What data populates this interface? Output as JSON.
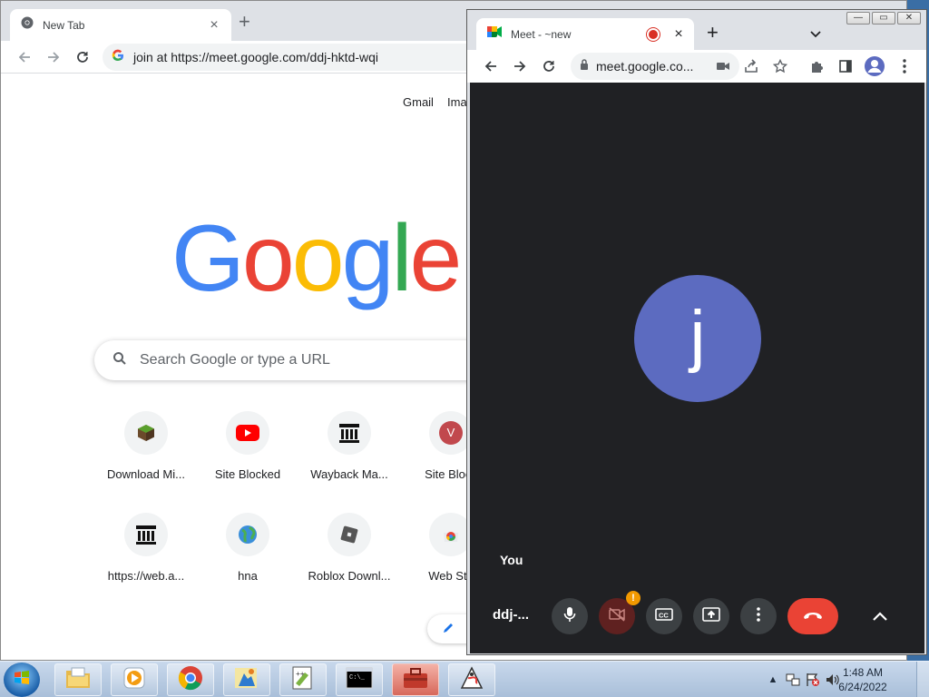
{
  "back_window": {
    "tab_title": "New Tab",
    "omnibox_text": "join at https://meet.google.com/ddj-hktd-wqi",
    "links": {
      "gmail": "Gmail",
      "images": "Ima"
    },
    "logo_letters": [
      "G",
      "o",
      "o",
      "g",
      "l",
      "e"
    ],
    "logo_colors": [
      "#4285f4",
      "#ea4335",
      "#fbbc05",
      "#4285f4",
      "#34a853",
      "#ea4335"
    ],
    "search_placeholder": "Search Google or type a URL",
    "shortcuts": [
      {
        "label": "Download Mi...",
        "icon": "minecraft-block-icon"
      },
      {
        "label": "Site Blocked",
        "icon": "youtube-icon"
      },
      {
        "label": "Wayback Ma...",
        "icon": "museum-icon"
      },
      {
        "label": "Site Block",
        "icon": "letter-v-icon",
        "letter": "V"
      },
      {
        "label": "https://web.a...",
        "icon": "museum-icon"
      },
      {
        "label": "hna",
        "icon": "globe-icon"
      },
      {
        "label": "Roblox Downl...",
        "icon": "roblox-icon"
      },
      {
        "label": "Web Sto",
        "icon": "chrome-webstore-icon"
      }
    ]
  },
  "front_window": {
    "tab_title": "Meet - ~new",
    "omnibox_text": "meet.google.co...",
    "avatar_letter": "j",
    "self_label": "You",
    "meeting_code": "ddj-...",
    "camera_alert": "!",
    "colors": {
      "stage": "#202124",
      "avatar": "#5c6bc0",
      "leave": "#ea4335",
      "alert": "#f29900"
    }
  },
  "taskbar": {
    "time": "1:48 AM",
    "date": "6/24/2022",
    "apps": [
      "explorer-icon",
      "media-player-icon",
      "chrome-icon",
      "paint-icon",
      "notepad-plus-icon",
      "command-prompt-icon",
      "toolbox-icon",
      "java-icon"
    ]
  }
}
